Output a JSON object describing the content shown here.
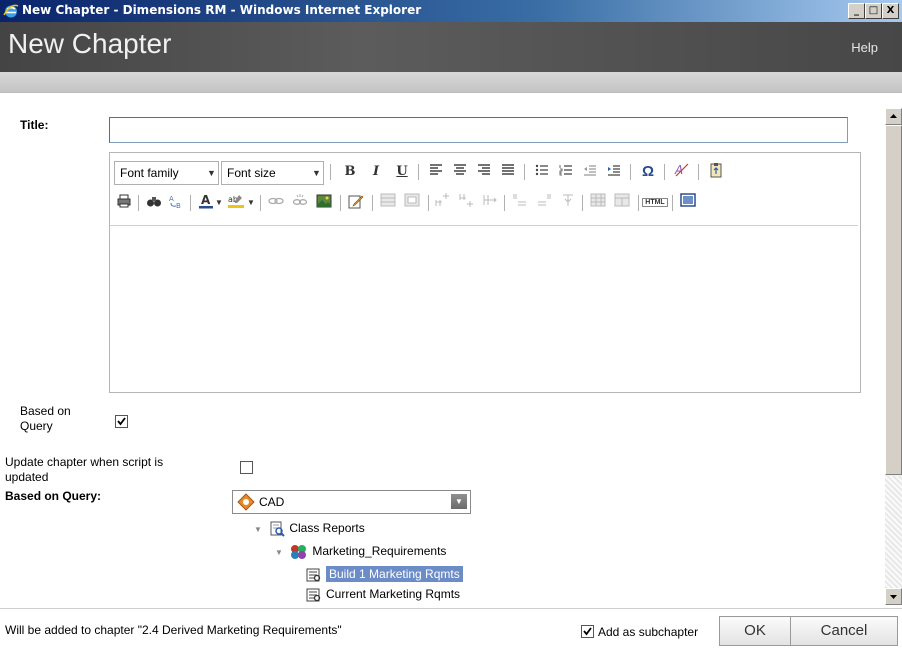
{
  "window": {
    "title": "New Chapter - Dimensions RM - Windows Internet Explorer",
    "minimize": "_",
    "maximize": "□",
    "close": "X"
  },
  "header": {
    "title": "New Chapter",
    "help_label": "Help"
  },
  "form": {
    "title_label": "Title:",
    "title_value": "",
    "editor": {
      "font_family_label": "Font family",
      "font_size_label": "Font size",
      "bold_label": "B",
      "italic_label": "I",
      "underline_label": "U",
      "omega_label": "Ω",
      "html_label": "HTML",
      "content": ""
    },
    "based_on_query_label_line1": "Based on",
    "based_on_query_label_line2": "Query",
    "based_on_query_checked": true,
    "update_chapter_label_line1": "Update chapter when script is",
    "update_chapter_label_line2": "updated",
    "update_chapter_checked": false,
    "query_label": "Based on Query:",
    "query_selected": "CAD",
    "tree": [
      {
        "label": "Class Reports",
        "level": 0
      },
      {
        "label": "Marketing_Requirements",
        "level": 1
      },
      {
        "label": "Build 1 Marketing Rqmts",
        "level": 2,
        "selected": true
      },
      {
        "label": "Current Marketing Rqmts",
        "level": 2
      }
    ]
  },
  "footer": {
    "status_text": "Will be added to chapter \"2.4 Derived Marketing Requirements\"",
    "add_subchapter_label": "Add as subchapter",
    "add_subchapter_checked": true,
    "ok_label": "OK",
    "cancel_label": "Cancel"
  },
  "colors": {
    "header_bg": "#4f4f4f",
    "selected_node": "#6b8cc6",
    "titlebar": "#0a246a"
  }
}
